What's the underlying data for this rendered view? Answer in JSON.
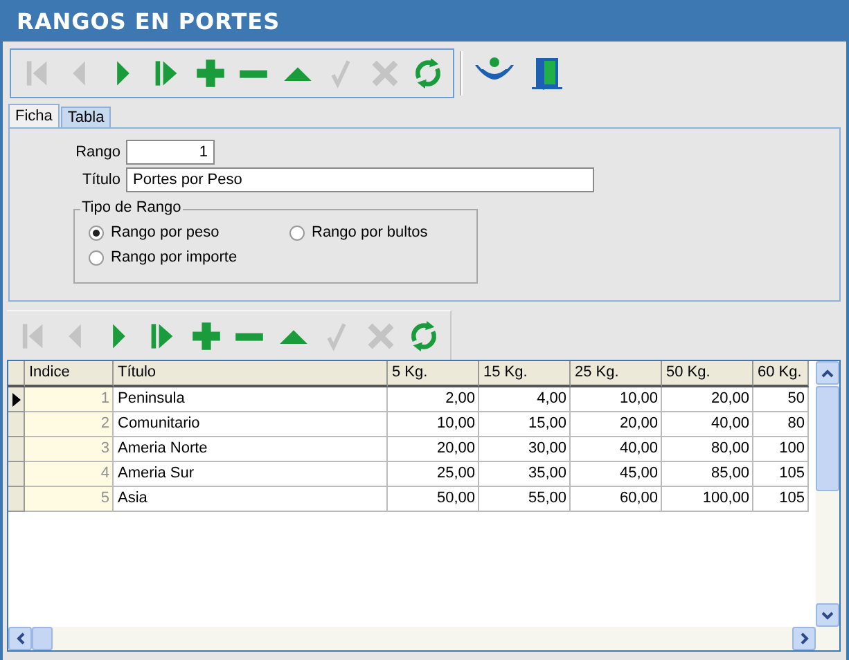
{
  "window": {
    "title": "RANGOS EN PORTES"
  },
  "toolbar": [
    {
      "kind": "first",
      "disabled": true
    },
    {
      "kind": "prev",
      "disabled": true
    },
    {
      "kind": "next",
      "disabled": false
    },
    {
      "kind": "last",
      "disabled": false
    },
    {
      "kind": "add",
      "disabled": false
    },
    {
      "kind": "delete",
      "disabled": false
    },
    {
      "kind": "up",
      "disabled": false
    },
    {
      "kind": "post",
      "disabled": true
    },
    {
      "kind": "cancel",
      "disabled": true
    },
    {
      "kind": "refresh",
      "disabled": false
    }
  ],
  "tabs": [
    {
      "label": "Ficha",
      "selected": true
    },
    {
      "label": "Tabla",
      "selected": false
    }
  ],
  "form": {
    "rango_label": "Rango",
    "rango_value": "1",
    "titulo_label": "Título",
    "titulo_value": "Portes por Peso",
    "group_title": "Tipo de Rango",
    "options": [
      {
        "label": "Rango por peso",
        "selected": true
      },
      {
        "label": "Rango por bultos",
        "selected": false
      },
      {
        "label": "Rango por importe",
        "selected": false
      }
    ]
  },
  "grid_toolbar": [
    {
      "kind": "first",
      "disabled": true
    },
    {
      "kind": "prev",
      "disabled": true
    },
    {
      "kind": "next",
      "disabled": false
    },
    {
      "kind": "last",
      "disabled": false
    },
    {
      "kind": "add",
      "disabled": false
    },
    {
      "kind": "delete",
      "disabled": false
    },
    {
      "kind": "up",
      "disabled": false
    },
    {
      "kind": "post",
      "disabled": true
    },
    {
      "kind": "cancel",
      "disabled": true
    },
    {
      "kind": "refresh",
      "disabled": false
    }
  ],
  "table": {
    "columns": [
      "Indice",
      "Título",
      "5 Kg.",
      "15 Kg.",
      "25 Kg.",
      "50 Kg.",
      "60 Kg."
    ],
    "rows": [
      {
        "current": true,
        "cells": [
          "1",
          "Peninsula",
          "2,00",
          "4,00",
          "10,00",
          "20,00",
          "50"
        ]
      },
      {
        "current": false,
        "cells": [
          "2",
          "Comunitario",
          "10,00",
          "15,00",
          "20,00",
          "40,00",
          "80"
        ]
      },
      {
        "current": false,
        "cells": [
          "3",
          "Ameria Norte",
          "20,00",
          "30,00",
          "40,00",
          "80,00",
          "100"
        ]
      },
      {
        "current": false,
        "cells": [
          "4",
          "Ameria Sur",
          "25,00",
          "35,00",
          "45,00",
          "85,00",
          "105"
        ]
      },
      {
        "current": false,
        "cells": [
          "5",
          "Asia",
          "50,00",
          "55,00",
          "60,00",
          "100,00",
          "105"
        ]
      }
    ]
  }
}
